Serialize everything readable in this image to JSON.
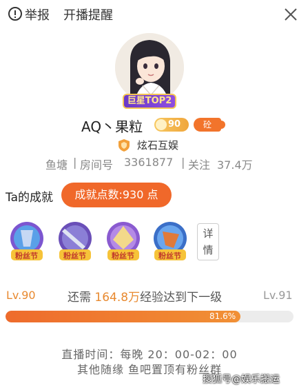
{
  "topbar": {
    "report_label": "举报",
    "remind_label": "开播提醒"
  },
  "profile": {
    "badge_text": "巨星TOP2",
    "name": "AQ丶果粒",
    "level_badge": "90",
    "guard_badge": "砼",
    "organization": "炫石互娱",
    "platform": "鱼塘",
    "room_label": "房间号",
    "room_number": "3361877",
    "follow_label": "关注",
    "follow_count": "37.4万"
  },
  "achievement": {
    "label": "Ta的成就",
    "points_text": "成就点数:930 点"
  },
  "medals": [
    {
      "name": "粉丝节",
      "color": "#5aa0e8"
    },
    {
      "name": "粉丝节",
      "color": "#6a4fb8"
    },
    {
      "name": "粉丝节",
      "color": "#8a5bd0"
    },
    {
      "name": "粉丝节",
      "color": "#4a8de0"
    }
  ],
  "detail_button": {
    "line1": "详",
    "line2": "情"
  },
  "level": {
    "current": "Lv.90",
    "prefix": "还需",
    "needed": "164.8万",
    "suffix": "经验达到下一级",
    "next": "Lv.91",
    "progress_percent": 81.6,
    "progress_text": "81.6%"
  },
  "schedule": {
    "live_time": "直播时间：每晚 20：00-02：00",
    "note": "其他随缘 鱼吧置顶有粉丝群"
  },
  "watermark": "搜狐号@娱乐搬运",
  "colors": {
    "accent": "#f0682a",
    "level": "#e8892f",
    "badge_purple": "#6a39c8"
  }
}
